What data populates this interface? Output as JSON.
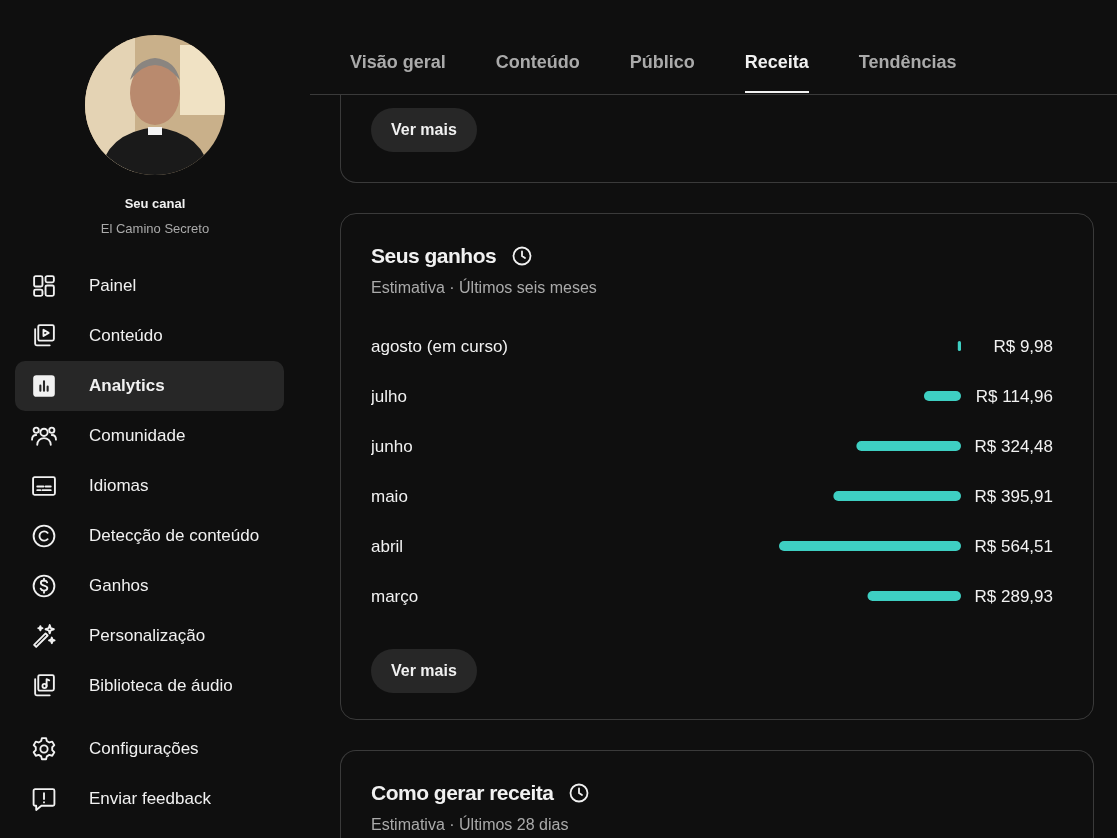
{
  "sidebar": {
    "channel_label": "Seu canal",
    "channel_name": "El Camino Secreto",
    "items": [
      {
        "label": "Painel",
        "selected": false
      },
      {
        "label": "Conteúdo",
        "selected": false
      },
      {
        "label": "Analytics",
        "selected": true
      },
      {
        "label": "Comunidade",
        "selected": false
      },
      {
        "label": "Idiomas",
        "selected": false
      },
      {
        "label": "Detecção de conteúdo",
        "selected": false
      },
      {
        "label": "Ganhos",
        "selected": false
      },
      {
        "label": "Personalização",
        "selected": false
      },
      {
        "label": "Biblioteca de áudio",
        "selected": false
      }
    ],
    "footer_items": [
      {
        "label": "Configurações"
      },
      {
        "label": "Enviar feedback"
      }
    ]
  },
  "tabs": [
    {
      "label": "Visão geral",
      "selected": false
    },
    {
      "label": "Conteúdo",
      "selected": false
    },
    {
      "label": "Público",
      "selected": false
    },
    {
      "label": "Receita",
      "selected": true
    },
    {
      "label": "Tendências",
      "selected": false
    }
  ],
  "cards": [
    {
      "kind": "more",
      "button": "Ver mais"
    },
    {
      "kind": "earnings",
      "title": "Seus ganhos",
      "subtitle": "Estimativa · Últimos seis meses",
      "chart_data": {
        "type": "bar",
        "orientation": "horizontal",
        "categories": [
          "agosto (em curso)",
          "julho",
          "junho",
          "maio",
          "abril",
          "março"
        ],
        "values": [
          9.98,
          114.96,
          324.48,
          395.91,
          564.51,
          289.93
        ],
        "value_labels": [
          "R$ 9,98",
          "R$ 114,96",
          "R$ 324,48",
          "R$ 395,91",
          "R$ 564,51",
          "R$ 289,93"
        ]
      },
      "button": "Ver mais"
    },
    {
      "kind": "partial",
      "title": "Como gerar receita",
      "subtitle": "Estimativa · Últimos 28 dias"
    }
  ]
}
